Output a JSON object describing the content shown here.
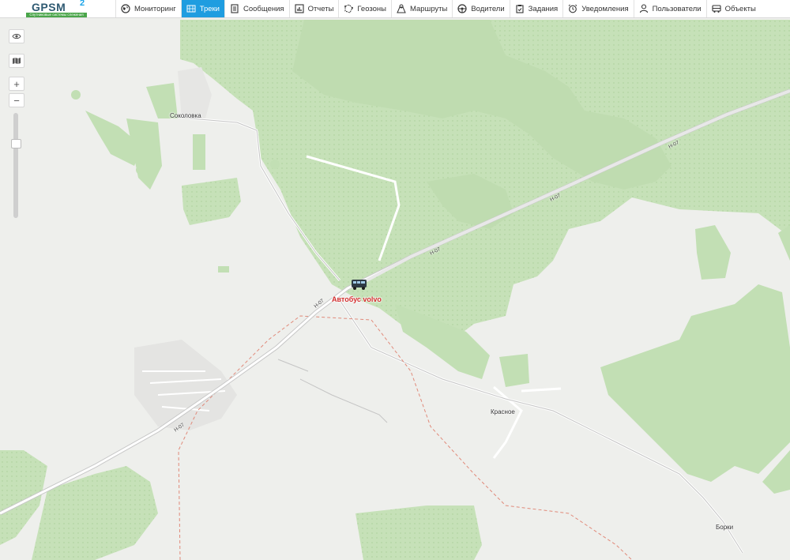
{
  "app": {
    "logo_text": "GPSM",
    "logo_superscript": "2",
    "logo_tagline": "Спутниковые системы слежения"
  },
  "nav": [
    {
      "label": "Мониторинг",
      "icon": "globe-icon",
      "active": false
    },
    {
      "label": "Треки",
      "icon": "track-icon",
      "active": true
    },
    {
      "label": "Сообщения",
      "icon": "messages-icon",
      "active": false
    },
    {
      "label": "Отчеты",
      "icon": "chart-icon",
      "active": false
    },
    {
      "label": "Геозоны",
      "icon": "geozone-icon",
      "active": false
    },
    {
      "label": "Маршруты",
      "icon": "route-icon",
      "active": false
    },
    {
      "label": "Водители",
      "icon": "steering-wheel-icon",
      "active": false
    },
    {
      "label": "Задания",
      "icon": "clipboard-icon",
      "active": false
    },
    {
      "label": "Уведомления",
      "icon": "alarm-clock-icon",
      "active": false
    },
    {
      "label": "Пользователи",
      "icon": "user-icon",
      "active": false
    },
    {
      "label": "Объекты",
      "icon": "bus-icon",
      "active": false
    }
  ],
  "map": {
    "places": [
      "Соколовка",
      "Красное",
      "Борки"
    ],
    "road": "Н-07",
    "vehicle": {
      "name": "Автобус volvo",
      "icon": "bus-icon",
      "label_color": "#d32d2d"
    },
    "controls": {
      "visibility": "eye-icon",
      "layers": "map-icon",
      "zoom_in": "+",
      "zoom_out": "−"
    }
  },
  "colors": {
    "accent": "#1f9de0",
    "forest": "#c2dfb4",
    "land": "#eeefec"
  }
}
